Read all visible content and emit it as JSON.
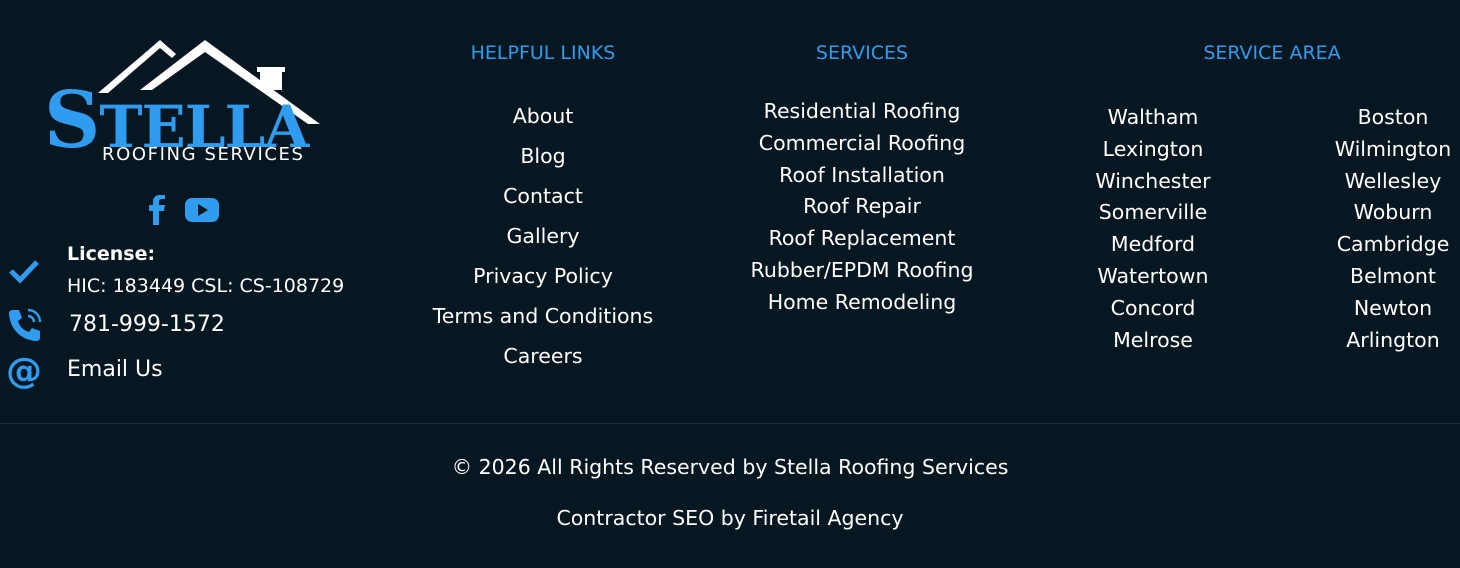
{
  "brand": {
    "logo_word_initial": "S",
    "logo_word_rest": "TELLA",
    "logo_subtitle": "ROOFING SERVICES",
    "accent_color": "#2f9cf0",
    "background_color": "#071722"
  },
  "social": [
    {
      "icon": "facebook-icon"
    },
    {
      "icon": "youtube-icon"
    }
  ],
  "contact": {
    "license_title": "License:",
    "license_text": "HIC: 183449 CSL: CS-108729",
    "phone": "781-999-1572",
    "email": "Email Us"
  },
  "helpful_links": {
    "title": "HELPFUL LINKS",
    "items": [
      "About",
      "Blog",
      "Contact",
      "Gallery",
      "Privacy Policy",
      "Terms and Conditions",
      "Careers"
    ]
  },
  "services": {
    "title": "SERVICES",
    "items": [
      "Residential Roofing",
      "Commercial Roofing",
      "Roof Installation",
      "Roof Repair",
      "Roof Replacement",
      "Rubber/EPDM Roofing",
      "Home Remodeling"
    ]
  },
  "service_area": {
    "title": "SERVICE AREA",
    "left": [
      "Waltham",
      "Lexington",
      "Winchester",
      "Somerville",
      "Medford",
      "Watertown",
      "Concord",
      "Melrose"
    ],
    "right": [
      "Boston",
      "Wilmington",
      "Wellesley",
      "Woburn",
      "Cambridge",
      "Belmont",
      "Newton",
      "Arlington"
    ]
  },
  "footer": {
    "copyright": "© 2026 All Rights Reserved by Stella Roofing Services",
    "credit": "Contractor SEO by Firetail Agency"
  }
}
